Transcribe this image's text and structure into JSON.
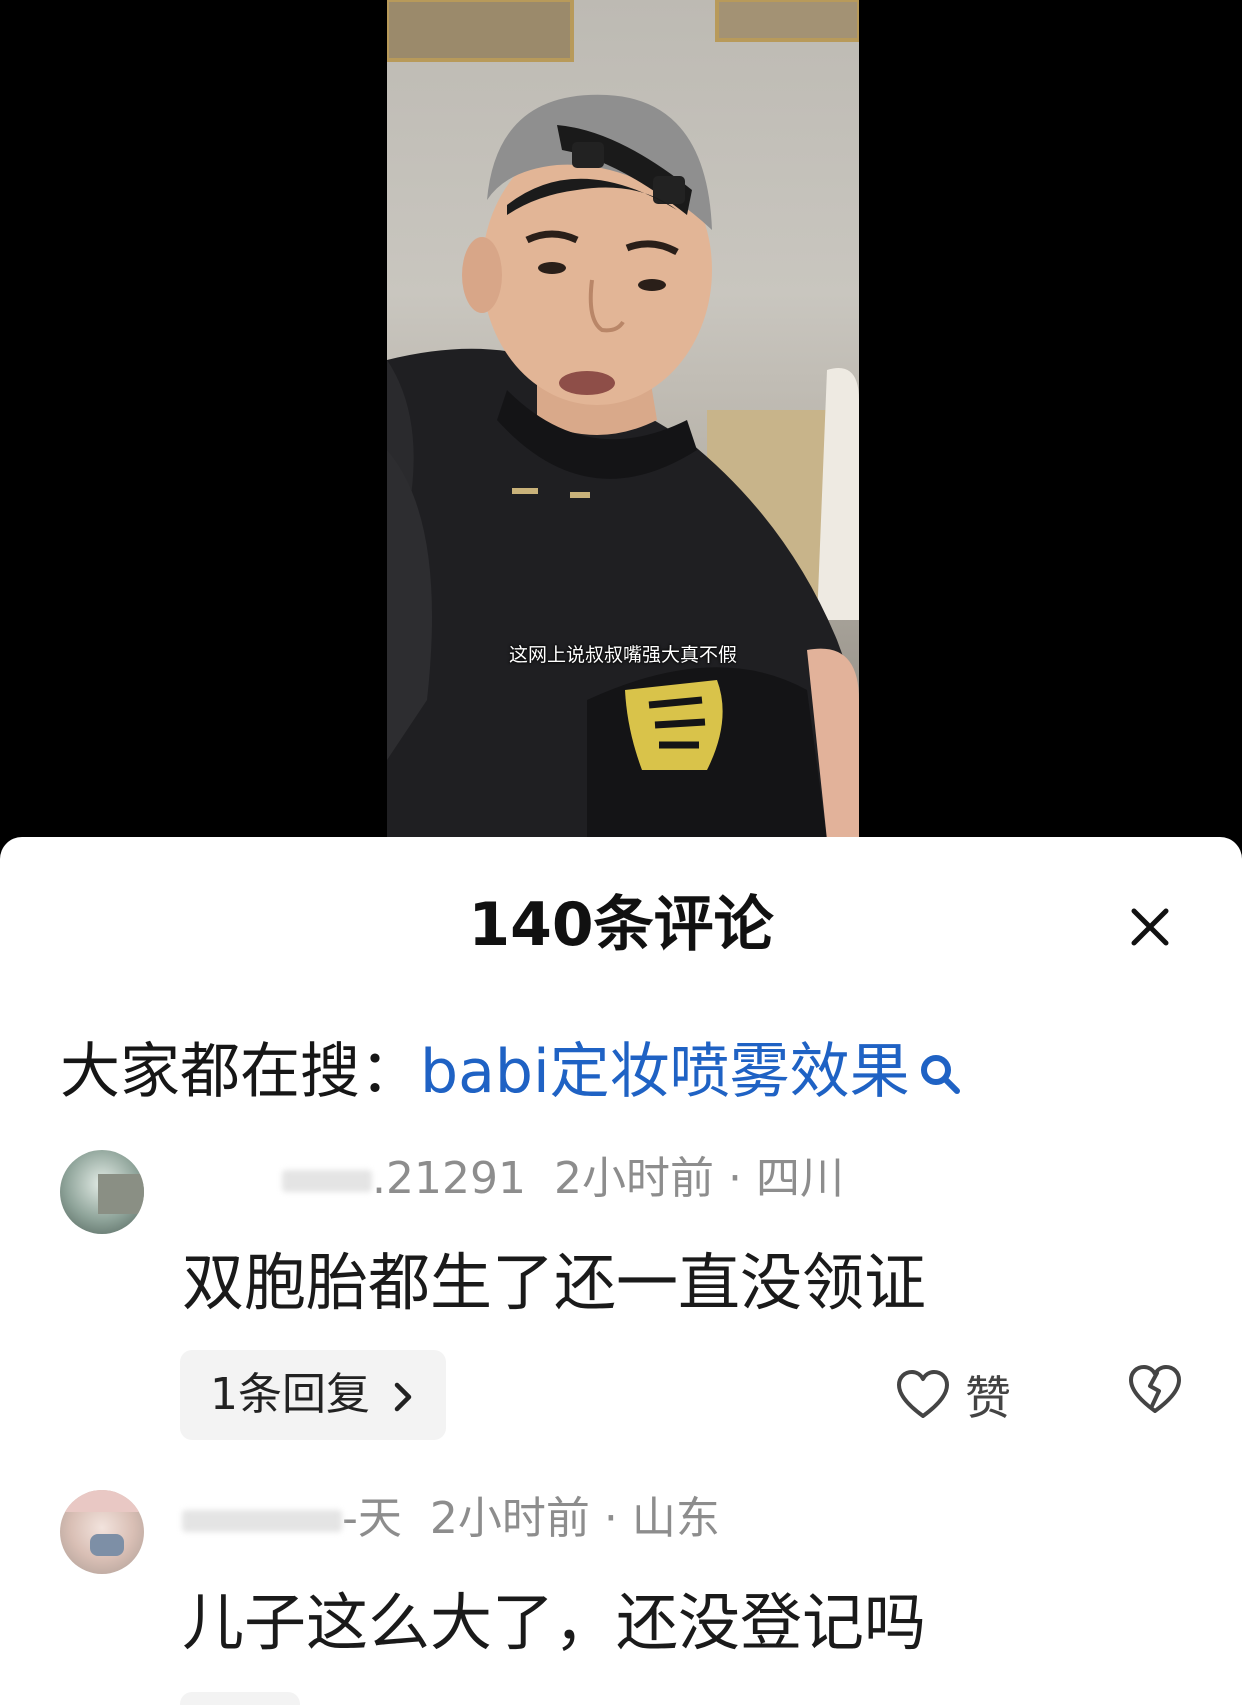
{
  "video": {
    "subtitle": "这网上说叔叔嘴强大真不假"
  },
  "comments_panel": {
    "title": "140条评论",
    "close_icon": "close-icon",
    "trending": {
      "label": "大家都在搜：",
      "query": "babi定妆喷雾效果",
      "icon": "search-icon"
    },
    "comments": [
      {
        "username_visible": ".21291",
        "time": "2小时前",
        "separator": "·",
        "location": "四川",
        "text": "双胞胎都生了还一直没领证",
        "reply_label": "1条回复",
        "like_label": "赞"
      },
      {
        "username_visible": "-天",
        "time": "2小时前",
        "separator": "·",
        "location": "山东",
        "text": "儿子这么大了，还没登记吗"
      }
    ]
  },
  "colors": {
    "accent_link": "#1f62c4",
    "meta_text": "#8d8d8d",
    "chip_bg": "#f3f3f3"
  }
}
